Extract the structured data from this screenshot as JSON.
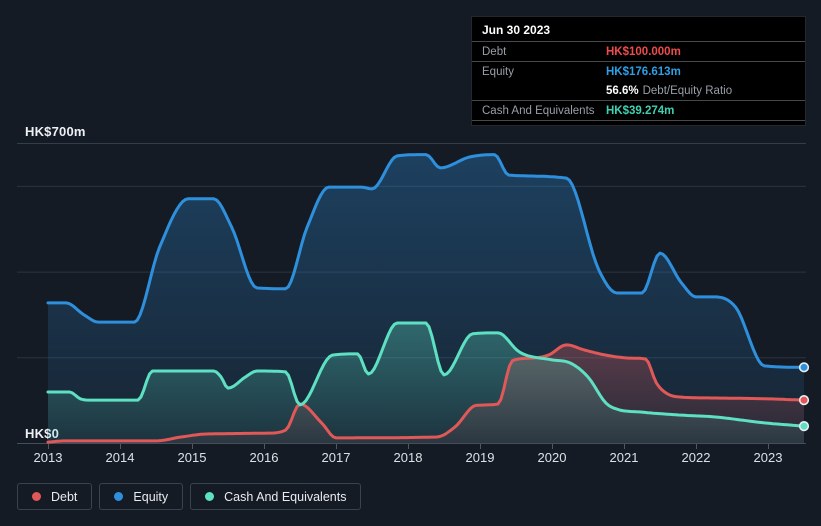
{
  "tooltip": {
    "date": "Jun 30 2023",
    "debt_label": "Debt",
    "debt_value": "HK$100.000m",
    "equity_label": "Equity",
    "equity_value": "HK$176.613m",
    "ratio_value": "56.6%",
    "ratio_label": "Debt/Equity Ratio",
    "cash_label": "Cash And Equivalents",
    "cash_value": "HK$39.274m"
  },
  "legend": {
    "debt": "Debt",
    "equity": "Equity",
    "cash": "Cash And Equivalents"
  },
  "axis": {
    "y_top": "HK$700m",
    "y_bottom": "HK$0"
  },
  "colors": {
    "debt": "#e05858",
    "equity": "#2e90dd",
    "cash": "#5ee0c2",
    "debt_value": "#ee4b4b",
    "equity_value": "#2e9fe6",
    "cash_value": "#3fd0b2",
    "background": "#151b24",
    "tooltip_bg": "#000000"
  },
  "chart_data": {
    "type": "area",
    "title": "Debt, Equity and Cash history (HK$m)",
    "xlabel": "",
    "ylabel": "HK$m",
    "ylim": [
      0,
      700
    ],
    "x_ticks": [
      2013,
      2014,
      2015,
      2016,
      2017,
      2018,
      2019,
      2020,
      2021,
      2022,
      2023
    ],
    "grid_values": [
      0,
      200,
      400,
      600,
      700
    ],
    "legend_position": "bottom",
    "series": [
      {
        "name": "Equity",
        "key": "equity",
        "color": "#2e90dd",
        "points": [
          [
            2013.0,
            327
          ],
          [
            2013.25,
            327
          ],
          [
            2013.5,
            299
          ],
          [
            2013.7,
            282
          ],
          [
            2014.2,
            282
          ],
          [
            2014.55,
            457
          ],
          [
            2014.95,
            570
          ],
          [
            2015.3,
            570
          ],
          [
            2015.55,
            504
          ],
          [
            2015.9,
            362
          ],
          [
            2016.3,
            360
          ],
          [
            2016.6,
            504
          ],
          [
            2016.9,
            597
          ],
          [
            2017.35,
            597
          ],
          [
            2017.5,
            593
          ],
          [
            2017.85,
            670
          ],
          [
            2018.25,
            673
          ],
          [
            2018.45,
            642
          ],
          [
            2018.85,
            667
          ],
          [
            2019.2,
            673
          ],
          [
            2019.4,
            625
          ],
          [
            2020.2,
            618
          ],
          [
            2020.65,
            404
          ],
          [
            2020.9,
            350
          ],
          [
            2021.25,
            350
          ],
          [
            2021.5,
            443
          ],
          [
            2021.8,
            373
          ],
          [
            2022.0,
            341
          ],
          [
            2022.25,
            341
          ],
          [
            2022.55,
            317
          ],
          [
            2022.95,
            180
          ],
          [
            2023.5,
            176.6
          ]
        ]
      },
      {
        "name": "Debt",
        "key": "debt",
        "color": "#e05858",
        "points": [
          [
            2013.0,
            2
          ],
          [
            2013.25,
            5
          ],
          [
            2014.5,
            5
          ],
          [
            2014.85,
            14
          ],
          [
            2015.2,
            21
          ],
          [
            2016.05,
            23
          ],
          [
            2016.3,
            30
          ],
          [
            2016.5,
            91
          ],
          [
            2016.8,
            47
          ],
          [
            2017.0,
            12
          ],
          [
            2018.4,
            14
          ],
          [
            2018.65,
            37
          ],
          [
            2018.95,
            88
          ],
          [
            2019.25,
            91
          ],
          [
            2019.45,
            192
          ],
          [
            2019.7,
            198
          ],
          [
            2019.95,
            205
          ],
          [
            2020.2,
            229
          ],
          [
            2020.45,
            217
          ],
          [
            2020.75,
            205
          ],
          [
            2021.1,
            198
          ],
          [
            2021.3,
            196
          ],
          [
            2021.45,
            140
          ],
          [
            2021.6,
            115
          ],
          [
            2021.8,
            107
          ],
          [
            2022.25,
            105
          ],
          [
            2023.0,
            103
          ],
          [
            2023.5,
            100
          ]
        ]
      },
      {
        "name": "Cash And Equivalents",
        "key": "cash",
        "color": "#5ee0c2",
        "points": [
          [
            2013.0,
            119
          ],
          [
            2013.3,
            119
          ],
          [
            2013.45,
            103
          ],
          [
            2013.6,
            100
          ],
          [
            2014.25,
            100
          ],
          [
            2014.45,
            168
          ],
          [
            2015.3,
            168
          ],
          [
            2015.4,
            155
          ],
          [
            2015.5,
            128
          ],
          [
            2015.75,
            155
          ],
          [
            2015.9,
            168
          ],
          [
            2016.3,
            166
          ],
          [
            2016.5,
            89
          ],
          [
            2016.95,
            205
          ],
          [
            2017.3,
            208
          ],
          [
            2017.45,
            161
          ],
          [
            2017.85,
            280
          ],
          [
            2018.25,
            280
          ],
          [
            2018.5,
            159
          ],
          [
            2018.9,
            255
          ],
          [
            2019.25,
            257
          ],
          [
            2019.55,
            212
          ],
          [
            2020.0,
            194
          ],
          [
            2020.25,
            187
          ],
          [
            2020.5,
            154
          ],
          [
            2020.75,
            93
          ],
          [
            2020.9,
            79
          ],
          [
            2021.25,
            72
          ],
          [
            2021.8,
            65
          ],
          [
            2022.25,
            61
          ],
          [
            2022.95,
            47
          ],
          [
            2023.5,
            39.3
          ]
        ]
      }
    ]
  }
}
